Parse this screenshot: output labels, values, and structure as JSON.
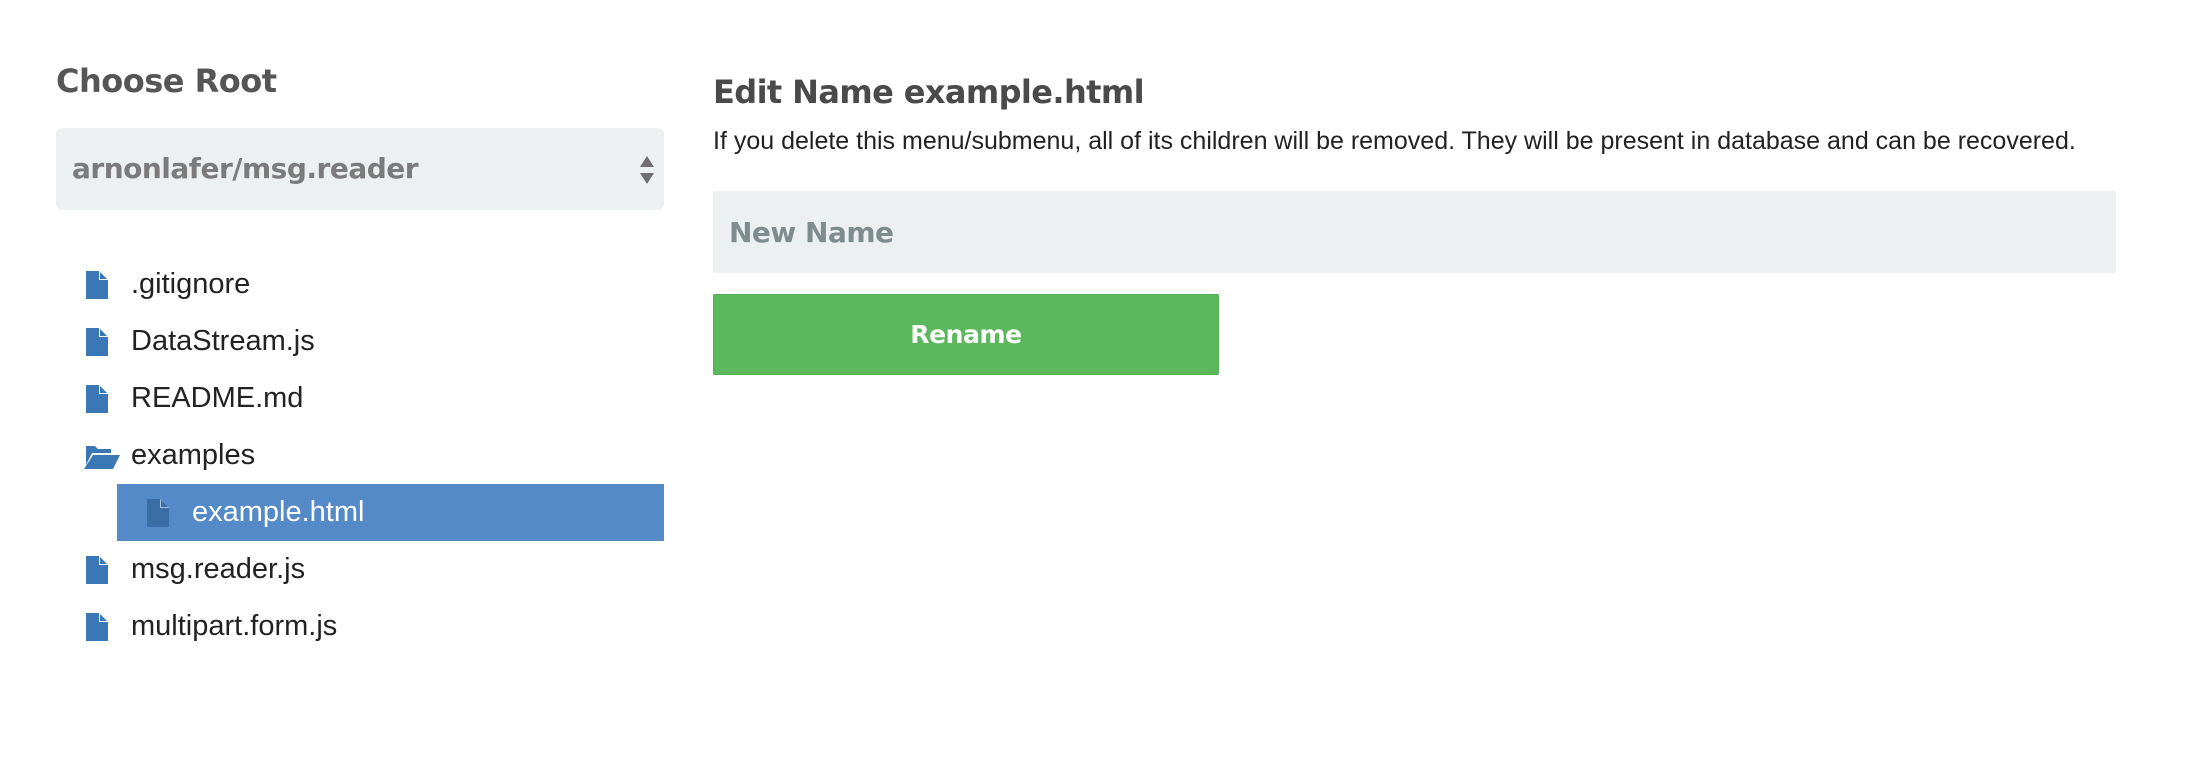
{
  "sidebar": {
    "title": "Choose Root",
    "root_select": {
      "selected": "arnonlafer/msg.reader"
    },
    "tree": [
      {
        "label": ".gitignore",
        "type": "file",
        "icon": "file-icon"
      },
      {
        "label": "DataStream.js",
        "type": "file",
        "icon": "file-icon"
      },
      {
        "label": "README.md",
        "type": "file",
        "icon": "file-icon"
      },
      {
        "label": "examples",
        "type": "folder",
        "icon": "folder-open-icon",
        "expanded": true
      },
      {
        "label": "example.html",
        "type": "file",
        "icon": "file-icon",
        "selected": true,
        "parent": "examples"
      },
      {
        "label": "msg.reader.js",
        "type": "file",
        "icon": "file-icon"
      },
      {
        "label": "multipart.form.js",
        "type": "file",
        "icon": "file-icon"
      }
    ]
  },
  "main": {
    "title": "Edit Name example.html",
    "info": "If you delete this menu/submenu, all of its children will be removed. They will be present in database and can be recovered.",
    "name_input": {
      "placeholder": "New Name",
      "value": ""
    },
    "rename_label": "Rename"
  },
  "colors": {
    "accent_selected": "#548ac7",
    "icon_blue": "#3a78b5",
    "button_green": "#5cb85c",
    "field_bg": "#ecf0f1"
  }
}
